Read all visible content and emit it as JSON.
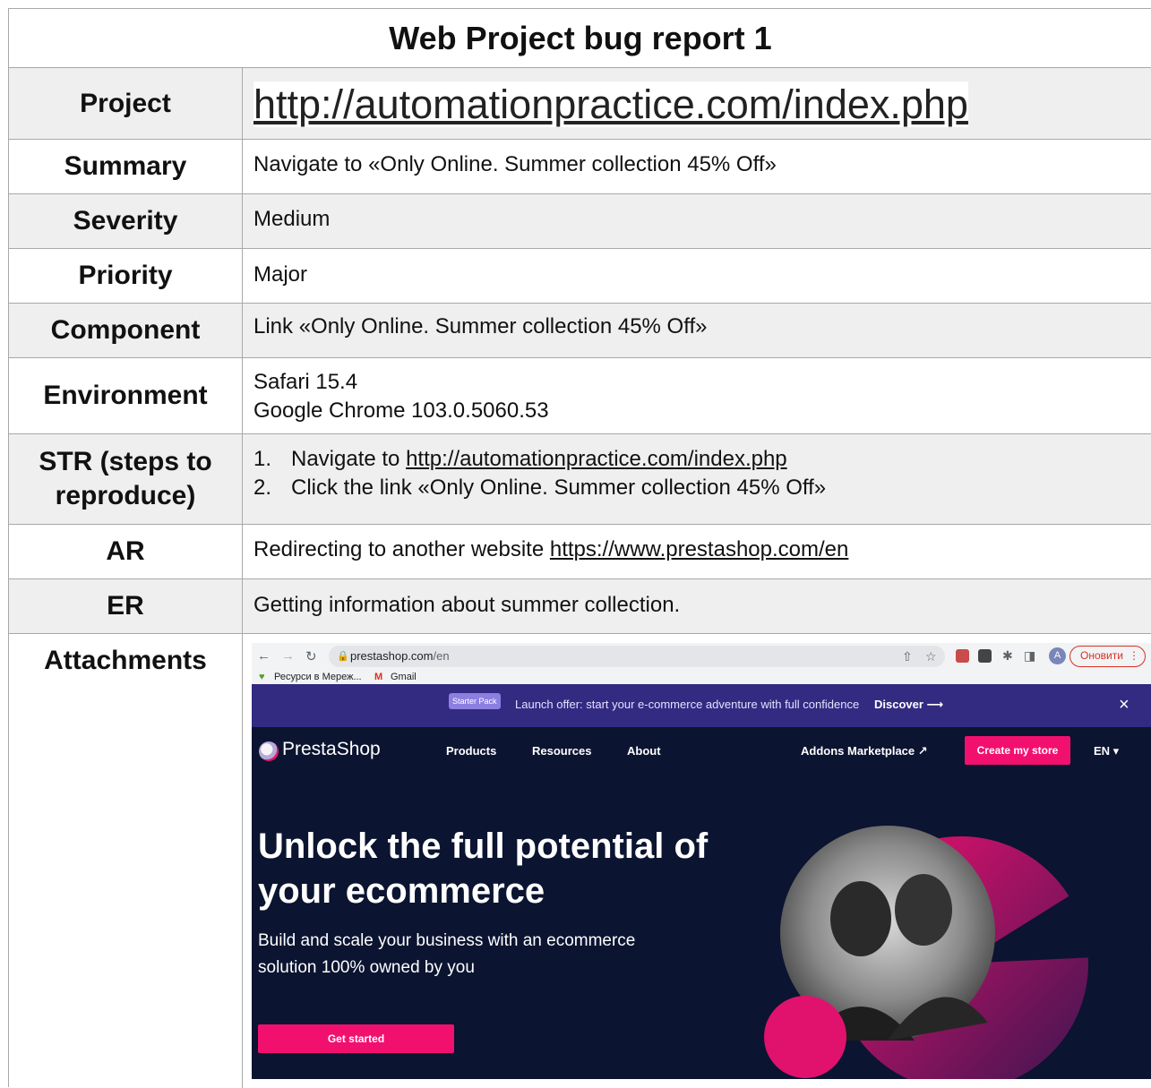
{
  "title": "Web Project bug report 1",
  "rows": [
    {
      "label": "Project",
      "value": "http://automationpractice.com/index.php"
    },
    {
      "label": "Summary",
      "value": "Navigate to «Only Online. Summer collection 45% Off»"
    },
    {
      "label": "Severity",
      "value": "Medium"
    },
    {
      "label": "Priority",
      "value": "Major"
    },
    {
      "label": "Component",
      "value": "Link «Only Online. Summer collection 45% Off»"
    },
    {
      "label": "Environment",
      "lines": [
        "Safari 15.4",
        "Google Chrome 103.0.5060.53"
      ]
    },
    {
      "label": "STR (steps to reproduce)",
      "steps": [
        {
          "num": "1.",
          "text": "Navigate to ",
          "link": "http://automationpractice.com/index.php"
        },
        {
          "num": "2.",
          "text": "Click the link «Only Online. Summer collection 45% Off»"
        }
      ]
    },
    {
      "label": "AR",
      "text": "Redirecting to another website ",
      "link": "https://www.prestashop.com/en"
    },
    {
      "label": "ER",
      "value": "Getting information about summer collection."
    },
    {
      "label": "Attachments"
    }
  ],
  "screenshot": {
    "browser": {
      "url_host": "prestashop.com",
      "url_path": "/en",
      "update_button": "Оновити",
      "avatar_letter": "A",
      "bookmarks": [
        "Ресурси в Мереж...",
        "Gmail"
      ]
    },
    "promo": {
      "badge": "Starter Pack",
      "text": "Launch offer: start your e-commerce adventure with full confidence",
      "link": "Discover ⟶",
      "close": "×"
    },
    "nav": {
      "logo": "PrestaShop",
      "links": [
        "Products",
        "Resources",
        "About"
      ],
      "marketplace": "Addons Marketplace ↗",
      "cta": "Create my store",
      "lang": "EN ▾"
    },
    "hero": {
      "title": "Unlock the full potential of your ecommerce",
      "subtitle": "Build and scale your business with an ecommerce solution 100% owned by you",
      "button": "Get started"
    },
    "colors": {
      "page_bg": "#0b1430",
      "promo_bg": "#332a82",
      "accent": "#f2106f"
    }
  }
}
